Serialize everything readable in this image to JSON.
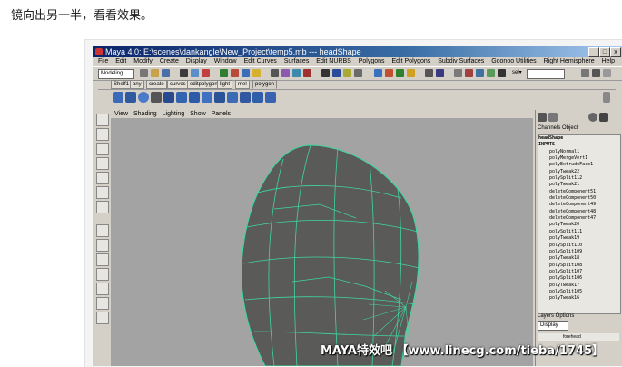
{
  "caption": "镜向出另一半，看看效果。",
  "window": {
    "title": "Maya 4.0: E:\\scenes\\dankangle\\New_Project\\temp5.mb  ---  headShape",
    "min_label": "_",
    "max_label": "□",
    "close_label": "x"
  },
  "menu": [
    "File",
    "Edit",
    "Modify",
    "Create",
    "Display",
    "Window",
    "Edit Curves",
    "Surfaces",
    "Edit NURBS",
    "Polygons",
    "Edit Polygons",
    "Subdiv Surfaces",
    "Goonoo Utilities",
    "Right Hemisphere",
    "Help"
  ],
  "status_line": {
    "mode": "Modeling",
    "sel_label": "sel▾"
  },
  "shelf_tabs": [
    "Shelf1",
    "any",
    "create",
    "curves",
    "editpolygon",
    "light",
    "mel",
    "polygon"
  ],
  "viewport_menu": [
    "View",
    "Shading",
    "Lighting",
    "Show",
    "Panels"
  ],
  "channel_box": {
    "tabs": "Channels  Object",
    "node": "headShape",
    "inputs_label": "INPUTS",
    "history": [
      "polyNormal1",
      "polyMergeVert1",
      "polyExtrudeFace1",
      "polyTweak22",
      "polySplit112",
      "polyTweak21",
      "deleteComponent51",
      "deleteComponent50",
      "deleteComponent49",
      "deleteComponent48",
      "deleteComponent47",
      "polyTweak20",
      "polySplit111",
      "polyTweak19",
      "polySplit110",
      "polySplit109",
      "polyTweak18",
      "polySplit108",
      "polySplit107",
      "polySplit106",
      "polyTweak17",
      "polySplit105",
      "polyTweak16"
    ]
  },
  "layers": {
    "header": "Layers  Options",
    "dropdown": "Display",
    "layer_name": "forehead"
  },
  "watermark": "MAYA特效吧 【www.linecg.com/tieba/1745】",
  "colors": {
    "viewport_bg": "#a3a3a3",
    "wireframe": "#3fd6a0",
    "mesh": "#5a5a58",
    "ui_bg": "#d4d0c8",
    "title_start": "#0a246a"
  }
}
